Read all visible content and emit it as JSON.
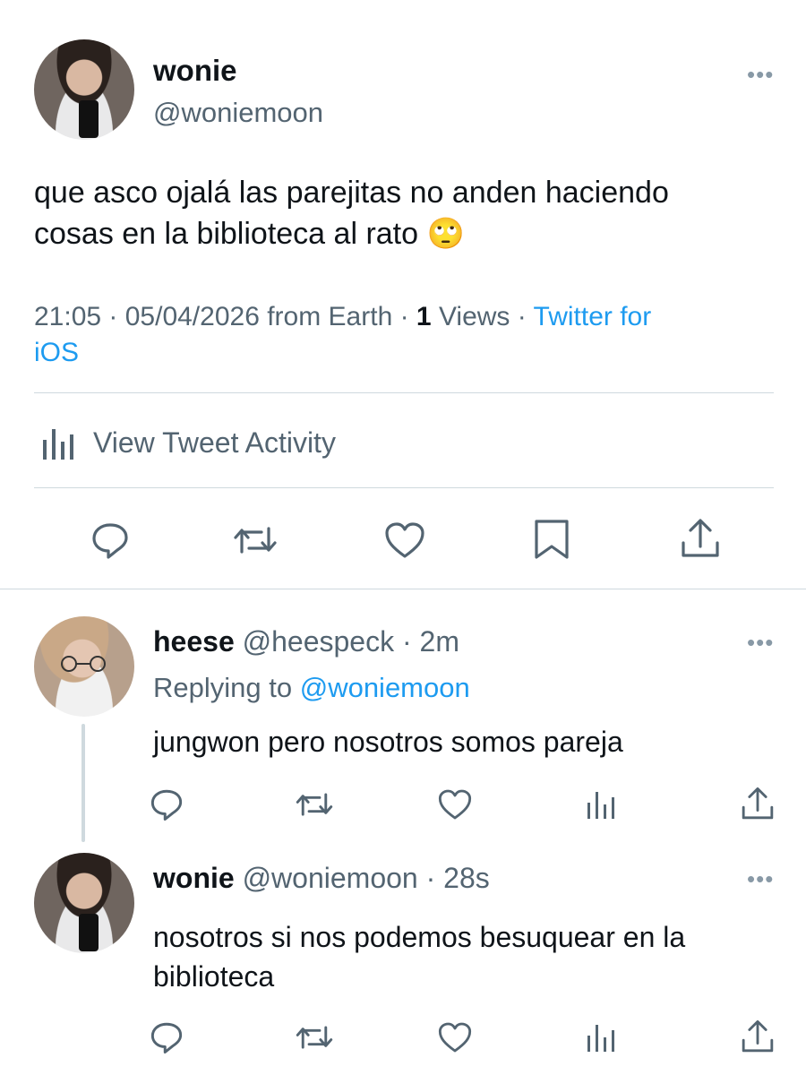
{
  "main_tweet": {
    "display_name": "wonie",
    "handle": "@woniemoon",
    "text_line1": "que asco ojalá las parejitas no anden haciendo",
    "text_line2": "cosas en la biblioteca al rato 🙄",
    "meta_time_date": "21:05 · 05/04/2026 from Earth · ",
    "meta_views_count": "1",
    "meta_views_label": " Views · ",
    "meta_source_part1": "Twitter for",
    "meta_source_part2": "iOS",
    "activity_label": "View Tweet Activity"
  },
  "replies": [
    {
      "display_name": "heese",
      "handle_time": "@heespeck · 2m",
      "replying_prefix": "Replying to ",
      "replying_handle": "@woniemoon",
      "text": "jungwon pero nosotros somos pareja"
    },
    {
      "display_name": "wonie",
      "handle_time": "@woniemoon · 28s",
      "text_line1": "nosotros si nos podemos besuquear en la",
      "text_line2": "biblioteca"
    }
  ],
  "icons": {
    "reply": "reply-icon",
    "retweet": "retweet-icon",
    "like": "heart-icon",
    "bookmark": "bookmark-icon",
    "share": "share-icon",
    "views": "bar-chart-icon",
    "more": "more-icon"
  },
  "colors": {
    "text": "#0f1419",
    "muted": "#536471",
    "link": "#1d9bf0",
    "divider": "#cfd9de"
  }
}
